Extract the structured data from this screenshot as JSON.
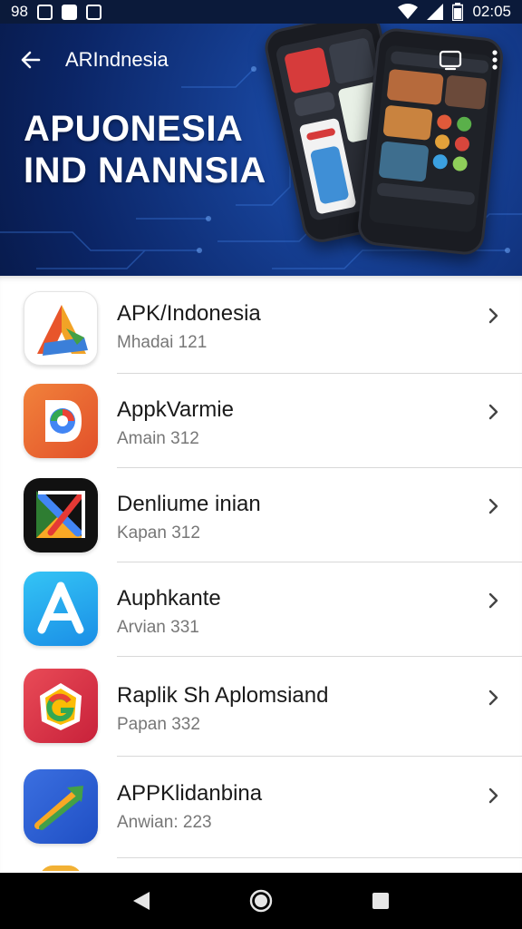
{
  "status_bar": {
    "left_text": "98",
    "time": "02:05"
  },
  "header": {
    "title": "ARIndnesia",
    "banner_line1": "APUONESIA",
    "banner_line2": "IND NANNSIA",
    "icons": [
      "back-arrow-icon",
      "cast-icon",
      "more-vert-icon"
    ]
  },
  "apps": [
    {
      "name": "APK/Indonesia",
      "subtitle": "Mhadai 121",
      "icon": "apk-indonesia-logo"
    },
    {
      "name": "AppkVarmie",
      "subtitle": "Amain 312",
      "icon": "appkvarmie-logo"
    },
    {
      "name": "Denliume inian",
      "subtitle": "Kapan 312",
      "icon": "denliume-logo"
    },
    {
      "name": "Auphkante",
      "subtitle": "Arvian 331",
      "icon": "auphkante-logo"
    },
    {
      "name": "Raplik Sh Aplomsiand",
      "subtitle": "Papan 332",
      "icon": "raplik-logo"
    },
    {
      "name": "APPKlidanbina",
      "subtitle": "Anwian: 223",
      "icon": "appklidanbina-logo"
    }
  ],
  "nav": {
    "icons": [
      "back-triangle-icon",
      "home-circle-icon",
      "recents-square-icon"
    ]
  },
  "colors": {
    "header_bg": "#143b8c",
    "status_bg": "#0b1a3a",
    "nav_bg": "#000000",
    "divider": "#d8d8d8",
    "subtitle": "#777777"
  }
}
